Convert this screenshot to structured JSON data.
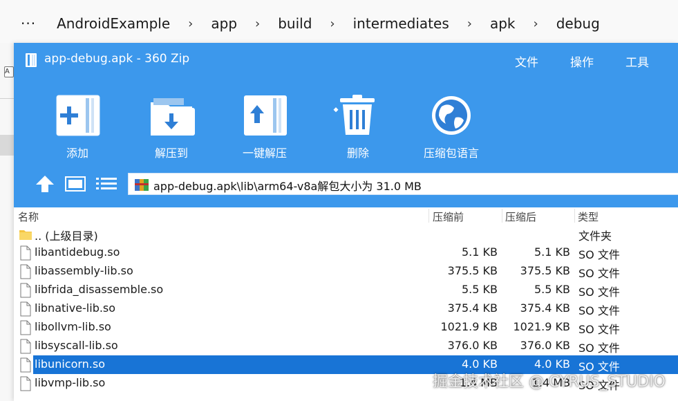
{
  "explorer": {
    "more": "···",
    "breadcrumb": [
      "AndroidExample",
      "app",
      "build",
      "intermediates",
      "apk",
      "debug"
    ],
    "mini_label": "A"
  },
  "window": {
    "title": "app-debug.apk - 360 Zip",
    "menu": [
      "文件",
      "操作",
      "工具"
    ],
    "accent": "#3c98ec"
  },
  "toolbar": {
    "add": "添加",
    "extract_to": "解压到",
    "one_click_extract": "一键解压",
    "delete": "删除",
    "language": "压缩包语言"
  },
  "nav": {
    "path": "app-debug.apk\\lib\\arm64-v8a解包大小为 31.0 MB"
  },
  "columns": {
    "name": "名称",
    "compressed": "压缩前",
    "packed": "压缩后",
    "type": "类型"
  },
  "files": [
    {
      "name": ".. (上级目录)",
      "before": "",
      "after": "",
      "type": "文件夹",
      "icon": "folder-icon"
    },
    {
      "name": "libantidebug.so",
      "before": "5.1 KB",
      "after": "5.1 KB",
      "type": "SO 文件",
      "icon": "file-icon"
    },
    {
      "name": "libassembly-lib.so",
      "before": "375.5 KB",
      "after": "375.5 KB",
      "type": "SO 文件",
      "icon": "file-icon"
    },
    {
      "name": "libfrida_disassemble.so",
      "before": "5.5 KB",
      "after": "5.5 KB",
      "type": "SO 文件",
      "icon": "file-icon"
    },
    {
      "name": "libnative-lib.so",
      "before": "375.4 KB",
      "after": "375.4 KB",
      "type": "SO 文件",
      "icon": "file-icon"
    },
    {
      "name": "libollvm-lib.so",
      "before": "1021.9 KB",
      "after": "1021.9 KB",
      "type": "SO 文件",
      "icon": "file-icon"
    },
    {
      "name": "libsyscall-lib.so",
      "before": "376.0 KB",
      "after": "376.0 KB",
      "type": "SO 文件",
      "icon": "file-icon"
    },
    {
      "name": "libunicorn.so",
      "before": "4.0 KB",
      "after": "4.0 KB",
      "type": "SO 文件",
      "icon": "file-icon",
      "selected": true
    },
    {
      "name": "libvmp-lib.so",
      "before": "1.4 MB",
      "after": "1.4 MB",
      "type": "SO 文件",
      "icon": "file-icon"
    }
  ],
  "watermark": "掘金技术社区 @ CYRUS_STUDIO",
  "colors": {
    "selection": "#1874d6"
  }
}
